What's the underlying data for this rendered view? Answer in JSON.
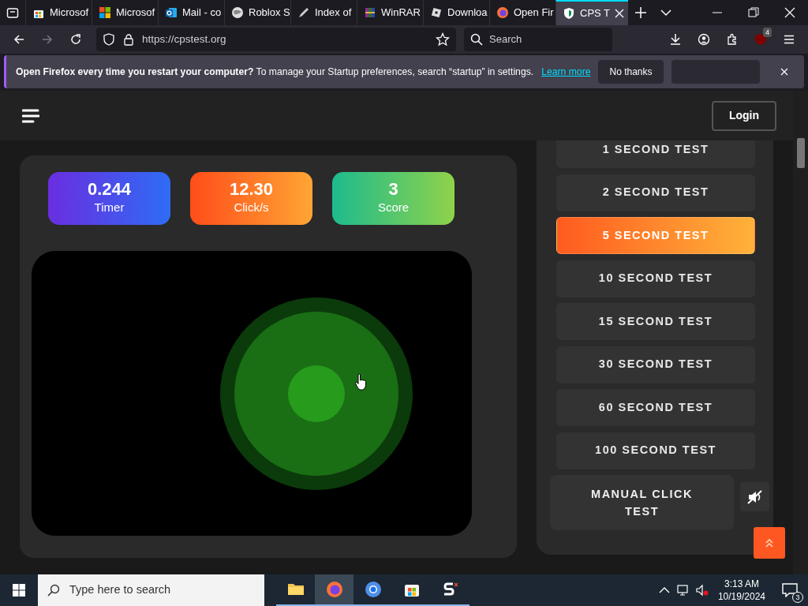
{
  "browser": {
    "tabs": [
      {
        "title": "Microsof",
        "kind": "store",
        "selected": false
      },
      {
        "title": "Microsof",
        "kind": "windows",
        "selected": false
      },
      {
        "title": "Mail - co",
        "kind": "mail",
        "selected": false
      },
      {
        "title": "Roblox S",
        "kind": "globe",
        "selected": false
      },
      {
        "title": "Index of",
        "kind": "pen",
        "selected": false
      },
      {
        "title": "WinRAR",
        "kind": "archive",
        "selected": false
      },
      {
        "title": "Downloa",
        "kind": "roblox",
        "selected": false
      },
      {
        "title": "Open Fir",
        "kind": "firefox",
        "selected": false
      },
      {
        "title": "CPS T",
        "kind": "cps",
        "selected": true
      }
    ],
    "address": "https://cpstest.org",
    "search_placeholder": "Search",
    "extensions_badge": "4"
  },
  "notification": {
    "text": "**Open Firefox every time you restart your computer?** To manage your Startup preferences, search “startup” in settings.",
    "link": "Learn more",
    "dismiss": "No thanks"
  },
  "site": {
    "login": "Login",
    "stats": [
      {
        "value": "0.244",
        "label": "Timer",
        "kind": "timer"
      },
      {
        "value": "12.30",
        "label": "Click/s",
        "kind": "rate"
      },
      {
        "value": "3",
        "label": "Score",
        "kind": "score"
      }
    ],
    "tests": [
      {
        "label": "1 SECOND TEST",
        "selected": false
      },
      {
        "label": "2 SECOND TEST",
        "selected": false
      },
      {
        "label": "5 SECOND TEST",
        "selected": true
      },
      {
        "label": "10 SECOND TEST",
        "selected": false
      },
      {
        "label": "15 SECOND TEST",
        "selected": false
      },
      {
        "label": "30 SECOND TEST",
        "selected": false
      },
      {
        "label": "60 SECOND TEST",
        "selected": false
      },
      {
        "label": "100 SECOND TEST",
        "selected": false
      }
    ],
    "manual": "MANUAL CLICK TEST"
  },
  "taskbar": {
    "search_placeholder": "Type here to search",
    "apps": [
      {
        "kind": "folder",
        "selected": false
      },
      {
        "kind": "firefox",
        "selected": true
      },
      {
        "kind": "chrome",
        "selected": false
      },
      {
        "kind": "store",
        "selected": false
      },
      {
        "kind": "s",
        "selected": false
      }
    ],
    "time": "3:13 AM",
    "date": "10/19/2024",
    "notifications": "3"
  }
}
